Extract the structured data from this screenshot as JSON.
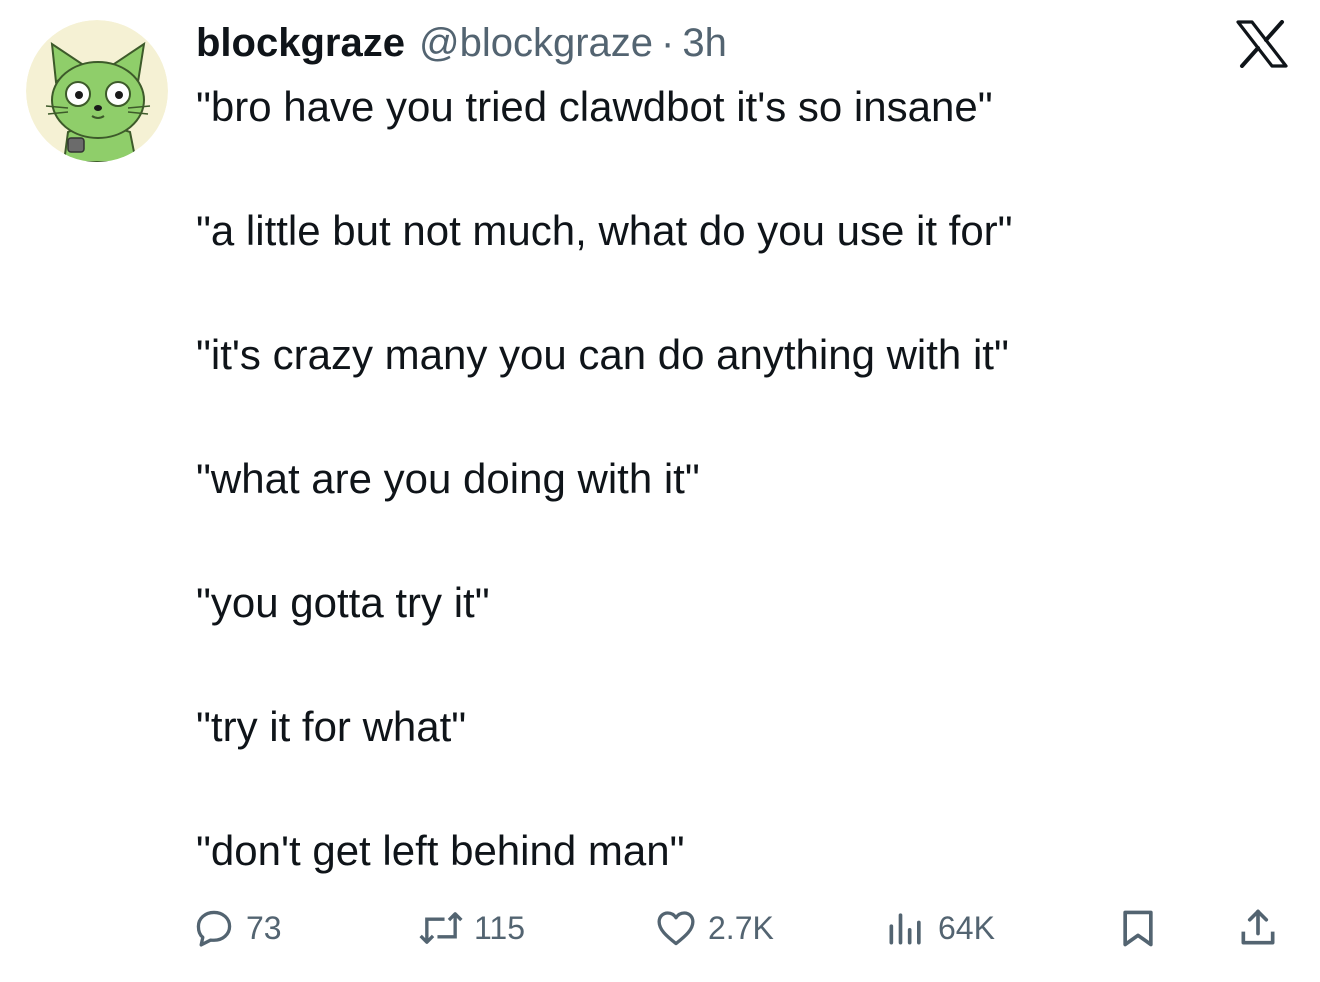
{
  "colors": {
    "text": "#0f1419",
    "secondary": "#536471",
    "avatar_bg": "#f5f1d4",
    "avatar_cat": "#8fce6a"
  },
  "author": {
    "display_name": "blockgraze",
    "handle": "@blockgraze",
    "separator": "·",
    "timestamp": "3h",
    "avatar_icon": "green-cat-avatar"
  },
  "brand_icon": "x-logo-icon",
  "tweet": {
    "lines": [
      "\"bro have you tried clawdbot it's so insane\"",
      "\"a little but not much, what do you use it for\"",
      "\"it's crazy many you can do anything with it\"",
      "\"what are you doing with it\"",
      "\"you gotta try it\"",
      "\"try it for what\"",
      "\"don't get left behind man\""
    ]
  },
  "actions": {
    "reply": {
      "icon": "reply-icon",
      "count": "73"
    },
    "retweet": {
      "icon": "retweet-icon",
      "count": "115"
    },
    "like": {
      "icon": "heart-icon",
      "count": "2.7K"
    },
    "views": {
      "icon": "views-chart-icon",
      "count": "64K"
    },
    "bookmark": {
      "icon": "bookmark-icon"
    },
    "share": {
      "icon": "share-icon"
    }
  }
}
